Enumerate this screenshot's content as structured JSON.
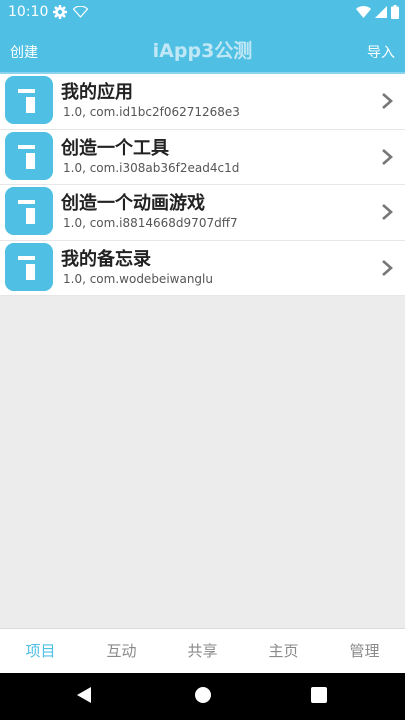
{
  "status": {
    "time": "10:10"
  },
  "header": {
    "left_label": "创建",
    "title": "iApp3公测",
    "right_label": "导入"
  },
  "projects": [
    {
      "name": "我的应用",
      "detail": "1.0, com.id1bc2f06271268e3"
    },
    {
      "name": "创造一个工具",
      "detail": "1.0, com.i308ab36f2ead4c1d"
    },
    {
      "name": "创造一个动画游戏",
      "detail": "1.0, com.i8814668d9707dff7"
    },
    {
      "name": "我的备忘录",
      "detail": "1.0, com.wodebeiwanglu"
    }
  ],
  "tabs": [
    {
      "label": "项目",
      "active": true
    },
    {
      "label": "互动"
    },
    {
      "label": "共享"
    },
    {
      "label": "主页"
    },
    {
      "label": "管理"
    }
  ],
  "colors": {
    "accent": "#4fc0e4",
    "tab_inactive": "#8a8a8a"
  },
  "icons": {
    "app_icon": "i-letter-icon",
    "chevron": "chevron-right-icon",
    "settings": "gear-icon",
    "nav_back": "triangle-back-icon",
    "nav_home": "circle-home-icon",
    "nav_recents": "square-recents-icon"
  }
}
